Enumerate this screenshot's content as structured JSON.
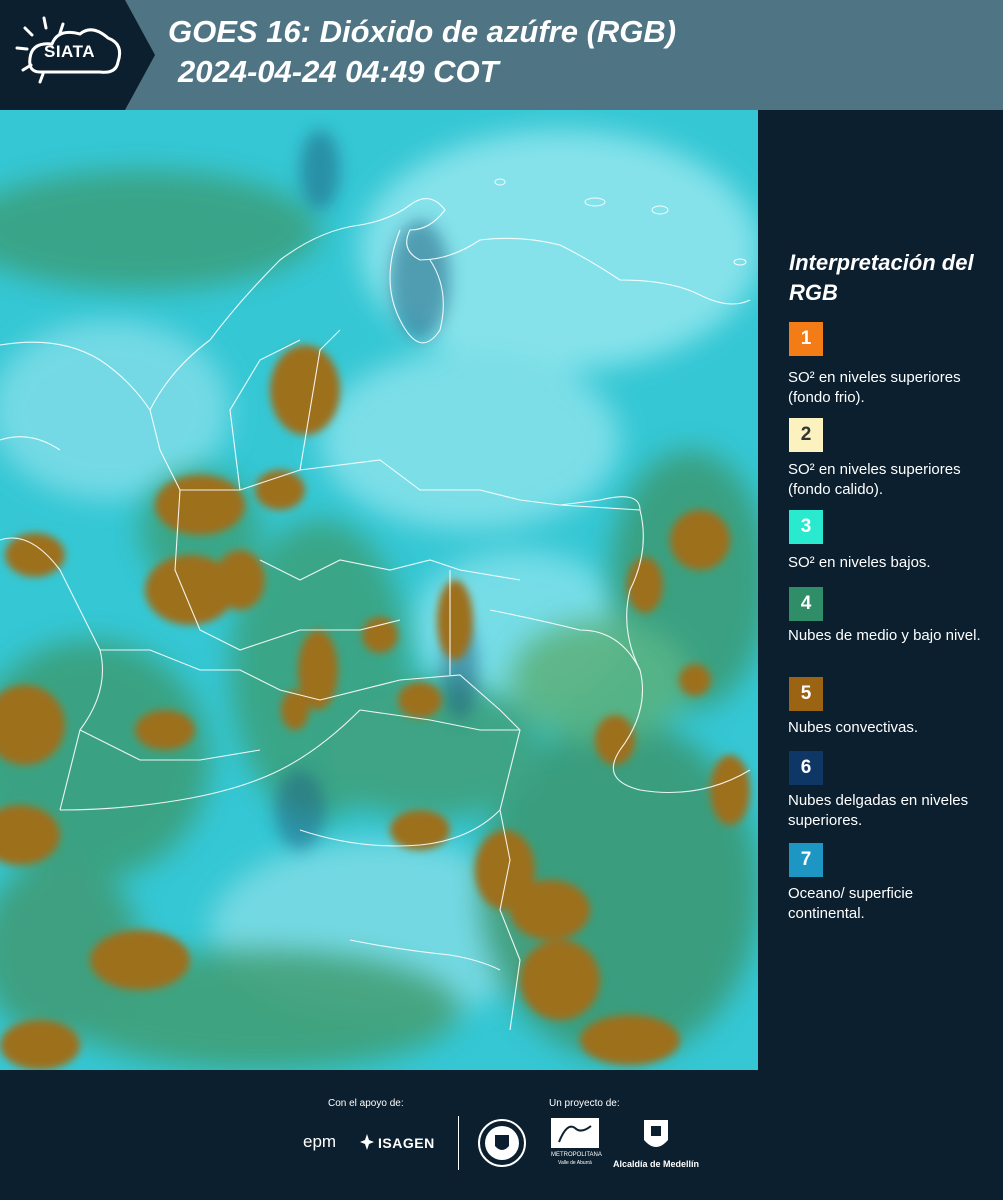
{
  "header": {
    "logo_text": "SIATA",
    "title_line1": "GOES 16: Dióxido de azúfre (RGB)",
    "title_line2": "2024-04-24 04:49 COT"
  },
  "legend": {
    "title": "Interpretación del RGB",
    "items": [
      {
        "number": "1",
        "color": "#f47c16",
        "text_color": "#ffffff",
        "desc": "SO² en niveles superiores (fondo frio)."
      },
      {
        "number": "2",
        "color": "#fbf2c0",
        "text_color": "#333333",
        "desc": "SO² en niveles superiores (fondo calido)."
      },
      {
        "number": "3",
        "color": "#29e9cf",
        "text_color": "#ffffff",
        "desc": "SO² en niveles bajos."
      },
      {
        "number": "4",
        "color": "#2f8e68",
        "text_color": "#ffffff",
        "desc": "Nubes de medio y bajo nivel."
      },
      {
        "number": "5",
        "color": "#9a6413",
        "text_color": "#ffffff",
        "desc": "Nubes convectivas."
      },
      {
        "number": "6",
        "color": "#0e3766",
        "text_color": "#ffffff",
        "desc": "Nubes delgadas en niveles superiores."
      },
      {
        "number": "7",
        "color": "#1d96c4",
        "text_color": "#ffffff",
        "desc": "Oceano/ superficie continental."
      }
    ]
  },
  "footer": {
    "support_label": "Con el apoyo de:",
    "project_label": "Un proyecto de:",
    "epm": "epm",
    "isagen": "ISAGEN",
    "area_metro": "METROPOLITANA",
    "area_sub": "Valle de Aburrá",
    "alcaldia": "Alcaldía de Medellín"
  },
  "colors": {
    "header_bg": "#4f7585",
    "panel_bg": "#0c1f2e",
    "map_base": "#2fc3d2",
    "convective": "#9a6413",
    "low_cloud": "#2f8e68",
    "border_lines": "#ffffff"
  }
}
